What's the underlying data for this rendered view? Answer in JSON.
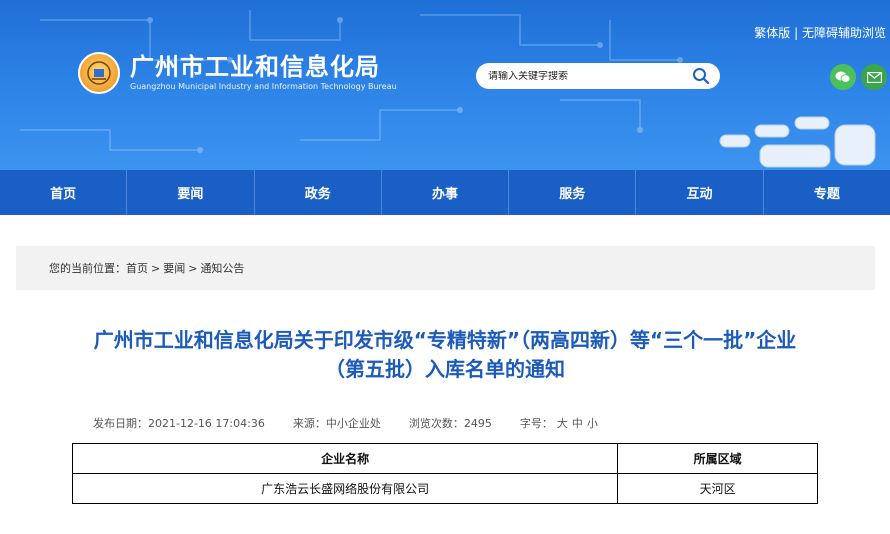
{
  "header": {
    "title_cn": "广州市工业和信息化局",
    "title_en": "Guangzhou Municipal Industry and Information Technology Bureau",
    "toplinks": {
      "traditional": "繁体版",
      "separator": "|",
      "accessible": "无障碍辅助浏览"
    },
    "search": {
      "placeholder": "请输入关键字搜索"
    },
    "colors": {
      "banner": "#2f85e8",
      "nav": "#1a5fc6",
      "title": "#1d5bb9"
    }
  },
  "nav": {
    "items": [
      {
        "label": "首页"
      },
      {
        "label": "要闻"
      },
      {
        "label": "政务"
      },
      {
        "label": "办事"
      },
      {
        "label": "服务"
      },
      {
        "label": "互动"
      },
      {
        "label": "专题"
      }
    ]
  },
  "breadcrumb": {
    "prefix": "您的当前位置：",
    "items": [
      "首页",
      "要闻",
      "通知公告"
    ],
    "separator": ">"
  },
  "article": {
    "title_line1": "广州市工业和信息化局关于印发市级“专精特新”（两高四新）等“三个一批”企业",
    "title_line2": "（第五批）入库名单的通知",
    "meta": {
      "date": "发布日期：2021-12-16 17:04:36",
      "source": "来源：中小企业处",
      "views": "浏览次数：2495",
      "fontsize_label": "字号：",
      "fontsize_options": [
        "大",
        "中",
        "小"
      ]
    },
    "table": {
      "headers": [
        "企业名称",
        "所属区域"
      ],
      "rows": [
        [
          "广东浩云长盛网络股份有限公司",
          "天河区"
        ]
      ]
    }
  }
}
